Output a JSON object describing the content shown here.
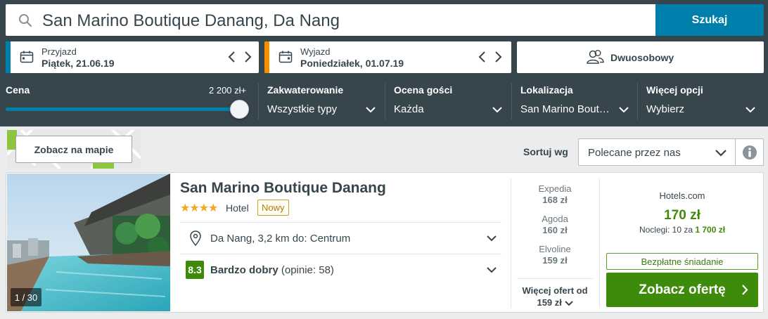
{
  "search": {
    "value": "San Marino Boutique Danang, Da Nang",
    "button_label": "Szukaj"
  },
  "checkin": {
    "label": "Przyjazd",
    "value": "Piątek, 21.06.19",
    "accent": "#007fad"
  },
  "checkout": {
    "label": "Wyjazd",
    "value": "Poniedziałek, 01.07.19",
    "accent": "#f48f00"
  },
  "room": {
    "value": "Dwuosobowy"
  },
  "filters": {
    "price": {
      "label": "Cena",
      "max_value": "2 200 zł+"
    },
    "accommodation": {
      "label": "Zakwaterowanie",
      "value": "Wszystkie typy"
    },
    "guest_rating": {
      "label": "Ocena gości",
      "value": "Każda"
    },
    "location": {
      "label": "Lokalizacja",
      "value": "San Marino Bout…"
    },
    "more": {
      "label": "Więcej opcji",
      "value": "Wybierz"
    }
  },
  "map_button": "Zobacz na mapie",
  "sort": {
    "label": "Sortuj wg",
    "value": "Polecane przez nas"
  },
  "hotel": {
    "name": "San Marino Boutique Danang",
    "stars": "★★★★",
    "type": "Hotel",
    "badge": "Nowy",
    "photo_count": "1 / 30",
    "location": "Da Nang, 3,2 km do: Centrum",
    "score": "8.3",
    "rating_text": "Bardzo dobry",
    "reviews": "(opinie: 58)",
    "providers": [
      {
        "name": "Expedia",
        "price": "168 zł"
      },
      {
        "name": "Agoda",
        "price": "160 zł"
      },
      {
        "name": "Elvoline",
        "price": "159 zł"
      }
    ],
    "more_offers_line1": "Więcej ofert od",
    "more_offers_line2": "159 zł",
    "best_deal": {
      "provider": "Hotels.com",
      "price": "170 zł",
      "nights_prefix": "Noclegi: 10 za",
      "total": "1 700 zł",
      "perk": "Bezpłatne śniadanie",
      "button": "Zobacz ofertę"
    }
  },
  "colors": {
    "header_bg": "#37454d",
    "primary_blue": "#007fad",
    "deal_green": "#3e8a0a",
    "star_gold": "#f5a623"
  }
}
